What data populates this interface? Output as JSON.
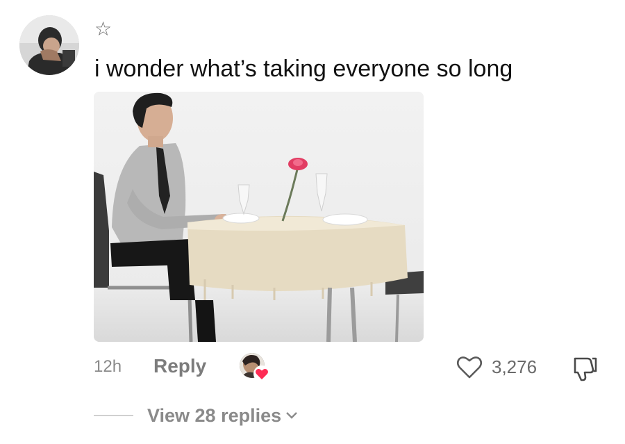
{
  "comment": {
    "text": "i wonder what’s taking everyone so long",
    "time": "12h",
    "reply_label": "Reply",
    "like_count": "3,276"
  },
  "replies": {
    "label": "View 28 replies"
  },
  "colors": {
    "heart_badge": "#fe2c55",
    "muted_text": "#8a8a8a",
    "reply_text": "#7c7c7c"
  },
  "icons": {
    "favorite": "star-outline-icon",
    "like": "heart-outline-icon",
    "dislike": "thumbs-down-icon",
    "expand": "chevron-down-icon",
    "creator_liked": "heart-badge-icon"
  }
}
